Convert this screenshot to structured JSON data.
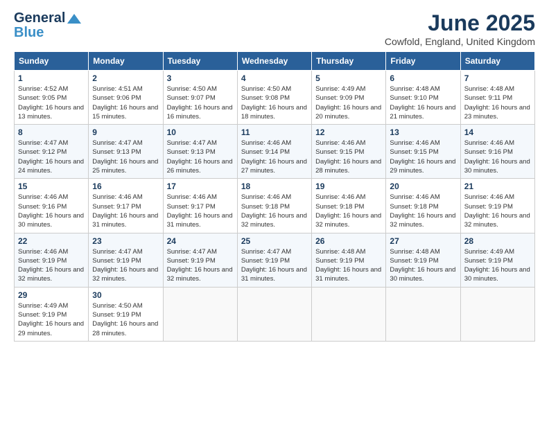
{
  "logo": {
    "general": "General",
    "blue": "Blue",
    "tagline": ""
  },
  "title": "June 2025",
  "subtitle": "Cowfold, England, United Kingdom",
  "days_of_week": [
    "Sunday",
    "Monday",
    "Tuesday",
    "Wednesday",
    "Thursday",
    "Friday",
    "Saturday"
  ],
  "weeks": [
    [
      {
        "day": "1",
        "sunrise": "4:52 AM",
        "sunset": "9:05 PM",
        "daylight": "16 hours and 13 minutes."
      },
      {
        "day": "2",
        "sunrise": "4:51 AM",
        "sunset": "9:06 PM",
        "daylight": "16 hours and 15 minutes."
      },
      {
        "day": "3",
        "sunrise": "4:50 AM",
        "sunset": "9:07 PM",
        "daylight": "16 hours and 16 minutes."
      },
      {
        "day": "4",
        "sunrise": "4:50 AM",
        "sunset": "9:08 PM",
        "daylight": "16 hours and 18 minutes."
      },
      {
        "day": "5",
        "sunrise": "4:49 AM",
        "sunset": "9:09 PM",
        "daylight": "16 hours and 20 minutes."
      },
      {
        "day": "6",
        "sunrise": "4:48 AM",
        "sunset": "9:10 PM",
        "daylight": "16 hours and 21 minutes."
      },
      {
        "day": "7",
        "sunrise": "4:48 AM",
        "sunset": "9:11 PM",
        "daylight": "16 hours and 23 minutes."
      }
    ],
    [
      {
        "day": "8",
        "sunrise": "4:47 AM",
        "sunset": "9:12 PM",
        "daylight": "16 hours and 24 minutes."
      },
      {
        "day": "9",
        "sunrise": "4:47 AM",
        "sunset": "9:13 PM",
        "daylight": "16 hours and 25 minutes."
      },
      {
        "day": "10",
        "sunrise": "4:47 AM",
        "sunset": "9:13 PM",
        "daylight": "16 hours and 26 minutes."
      },
      {
        "day": "11",
        "sunrise": "4:46 AM",
        "sunset": "9:14 PM",
        "daylight": "16 hours and 27 minutes."
      },
      {
        "day": "12",
        "sunrise": "4:46 AM",
        "sunset": "9:15 PM",
        "daylight": "16 hours and 28 minutes."
      },
      {
        "day": "13",
        "sunrise": "4:46 AM",
        "sunset": "9:15 PM",
        "daylight": "16 hours and 29 minutes."
      },
      {
        "day": "14",
        "sunrise": "4:46 AM",
        "sunset": "9:16 PM",
        "daylight": "16 hours and 30 minutes."
      }
    ],
    [
      {
        "day": "15",
        "sunrise": "4:46 AM",
        "sunset": "9:16 PM",
        "daylight": "16 hours and 30 minutes."
      },
      {
        "day": "16",
        "sunrise": "4:46 AM",
        "sunset": "9:17 PM",
        "daylight": "16 hours and 31 minutes."
      },
      {
        "day": "17",
        "sunrise": "4:46 AM",
        "sunset": "9:17 PM",
        "daylight": "16 hours and 31 minutes."
      },
      {
        "day": "18",
        "sunrise": "4:46 AM",
        "sunset": "9:18 PM",
        "daylight": "16 hours and 32 minutes."
      },
      {
        "day": "19",
        "sunrise": "4:46 AM",
        "sunset": "9:18 PM",
        "daylight": "16 hours and 32 minutes."
      },
      {
        "day": "20",
        "sunrise": "4:46 AM",
        "sunset": "9:18 PM",
        "daylight": "16 hours and 32 minutes."
      },
      {
        "day": "21",
        "sunrise": "4:46 AM",
        "sunset": "9:19 PM",
        "daylight": "16 hours and 32 minutes."
      }
    ],
    [
      {
        "day": "22",
        "sunrise": "4:46 AM",
        "sunset": "9:19 PM",
        "daylight": "16 hours and 32 minutes."
      },
      {
        "day": "23",
        "sunrise": "4:47 AM",
        "sunset": "9:19 PM",
        "daylight": "16 hours and 32 minutes."
      },
      {
        "day": "24",
        "sunrise": "4:47 AM",
        "sunset": "9:19 PM",
        "daylight": "16 hours and 32 minutes."
      },
      {
        "day": "25",
        "sunrise": "4:47 AM",
        "sunset": "9:19 PM",
        "daylight": "16 hours and 31 minutes."
      },
      {
        "day": "26",
        "sunrise": "4:48 AM",
        "sunset": "9:19 PM",
        "daylight": "16 hours and 31 minutes."
      },
      {
        "day": "27",
        "sunrise": "4:48 AM",
        "sunset": "9:19 PM",
        "daylight": "16 hours and 30 minutes."
      },
      {
        "day": "28",
        "sunrise": "4:49 AM",
        "sunset": "9:19 PM",
        "daylight": "16 hours and 30 minutes."
      }
    ],
    [
      {
        "day": "29",
        "sunrise": "4:49 AM",
        "sunset": "9:19 PM",
        "daylight": "16 hours and 29 minutes."
      },
      {
        "day": "30",
        "sunrise": "4:50 AM",
        "sunset": "9:19 PM",
        "daylight": "16 hours and 28 minutes."
      },
      null,
      null,
      null,
      null,
      null
    ]
  ]
}
